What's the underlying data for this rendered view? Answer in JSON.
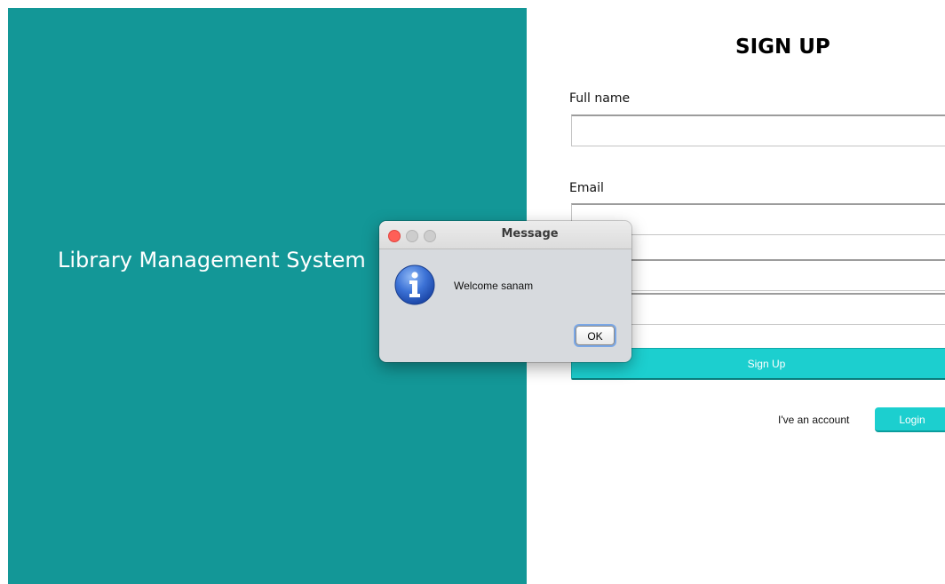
{
  "app": {
    "title": "Library Management System"
  },
  "form": {
    "heading": "SIGN UP",
    "full_name_label": "Full name",
    "full_name_value": "",
    "email_label": "Email",
    "email_value": "",
    "password_value": "",
    "confirm_value": "",
    "signup_label": "Sign Up",
    "have_account_text": "I've an account",
    "login_label": "Login"
  },
  "dialog": {
    "title": "Message",
    "message": "Welcome sanam",
    "ok_label": "OK",
    "icon": "info-icon"
  },
  "colors": {
    "panel": "#139797",
    "accent": "#1ccfcf",
    "close_button": "#ff5f57"
  }
}
